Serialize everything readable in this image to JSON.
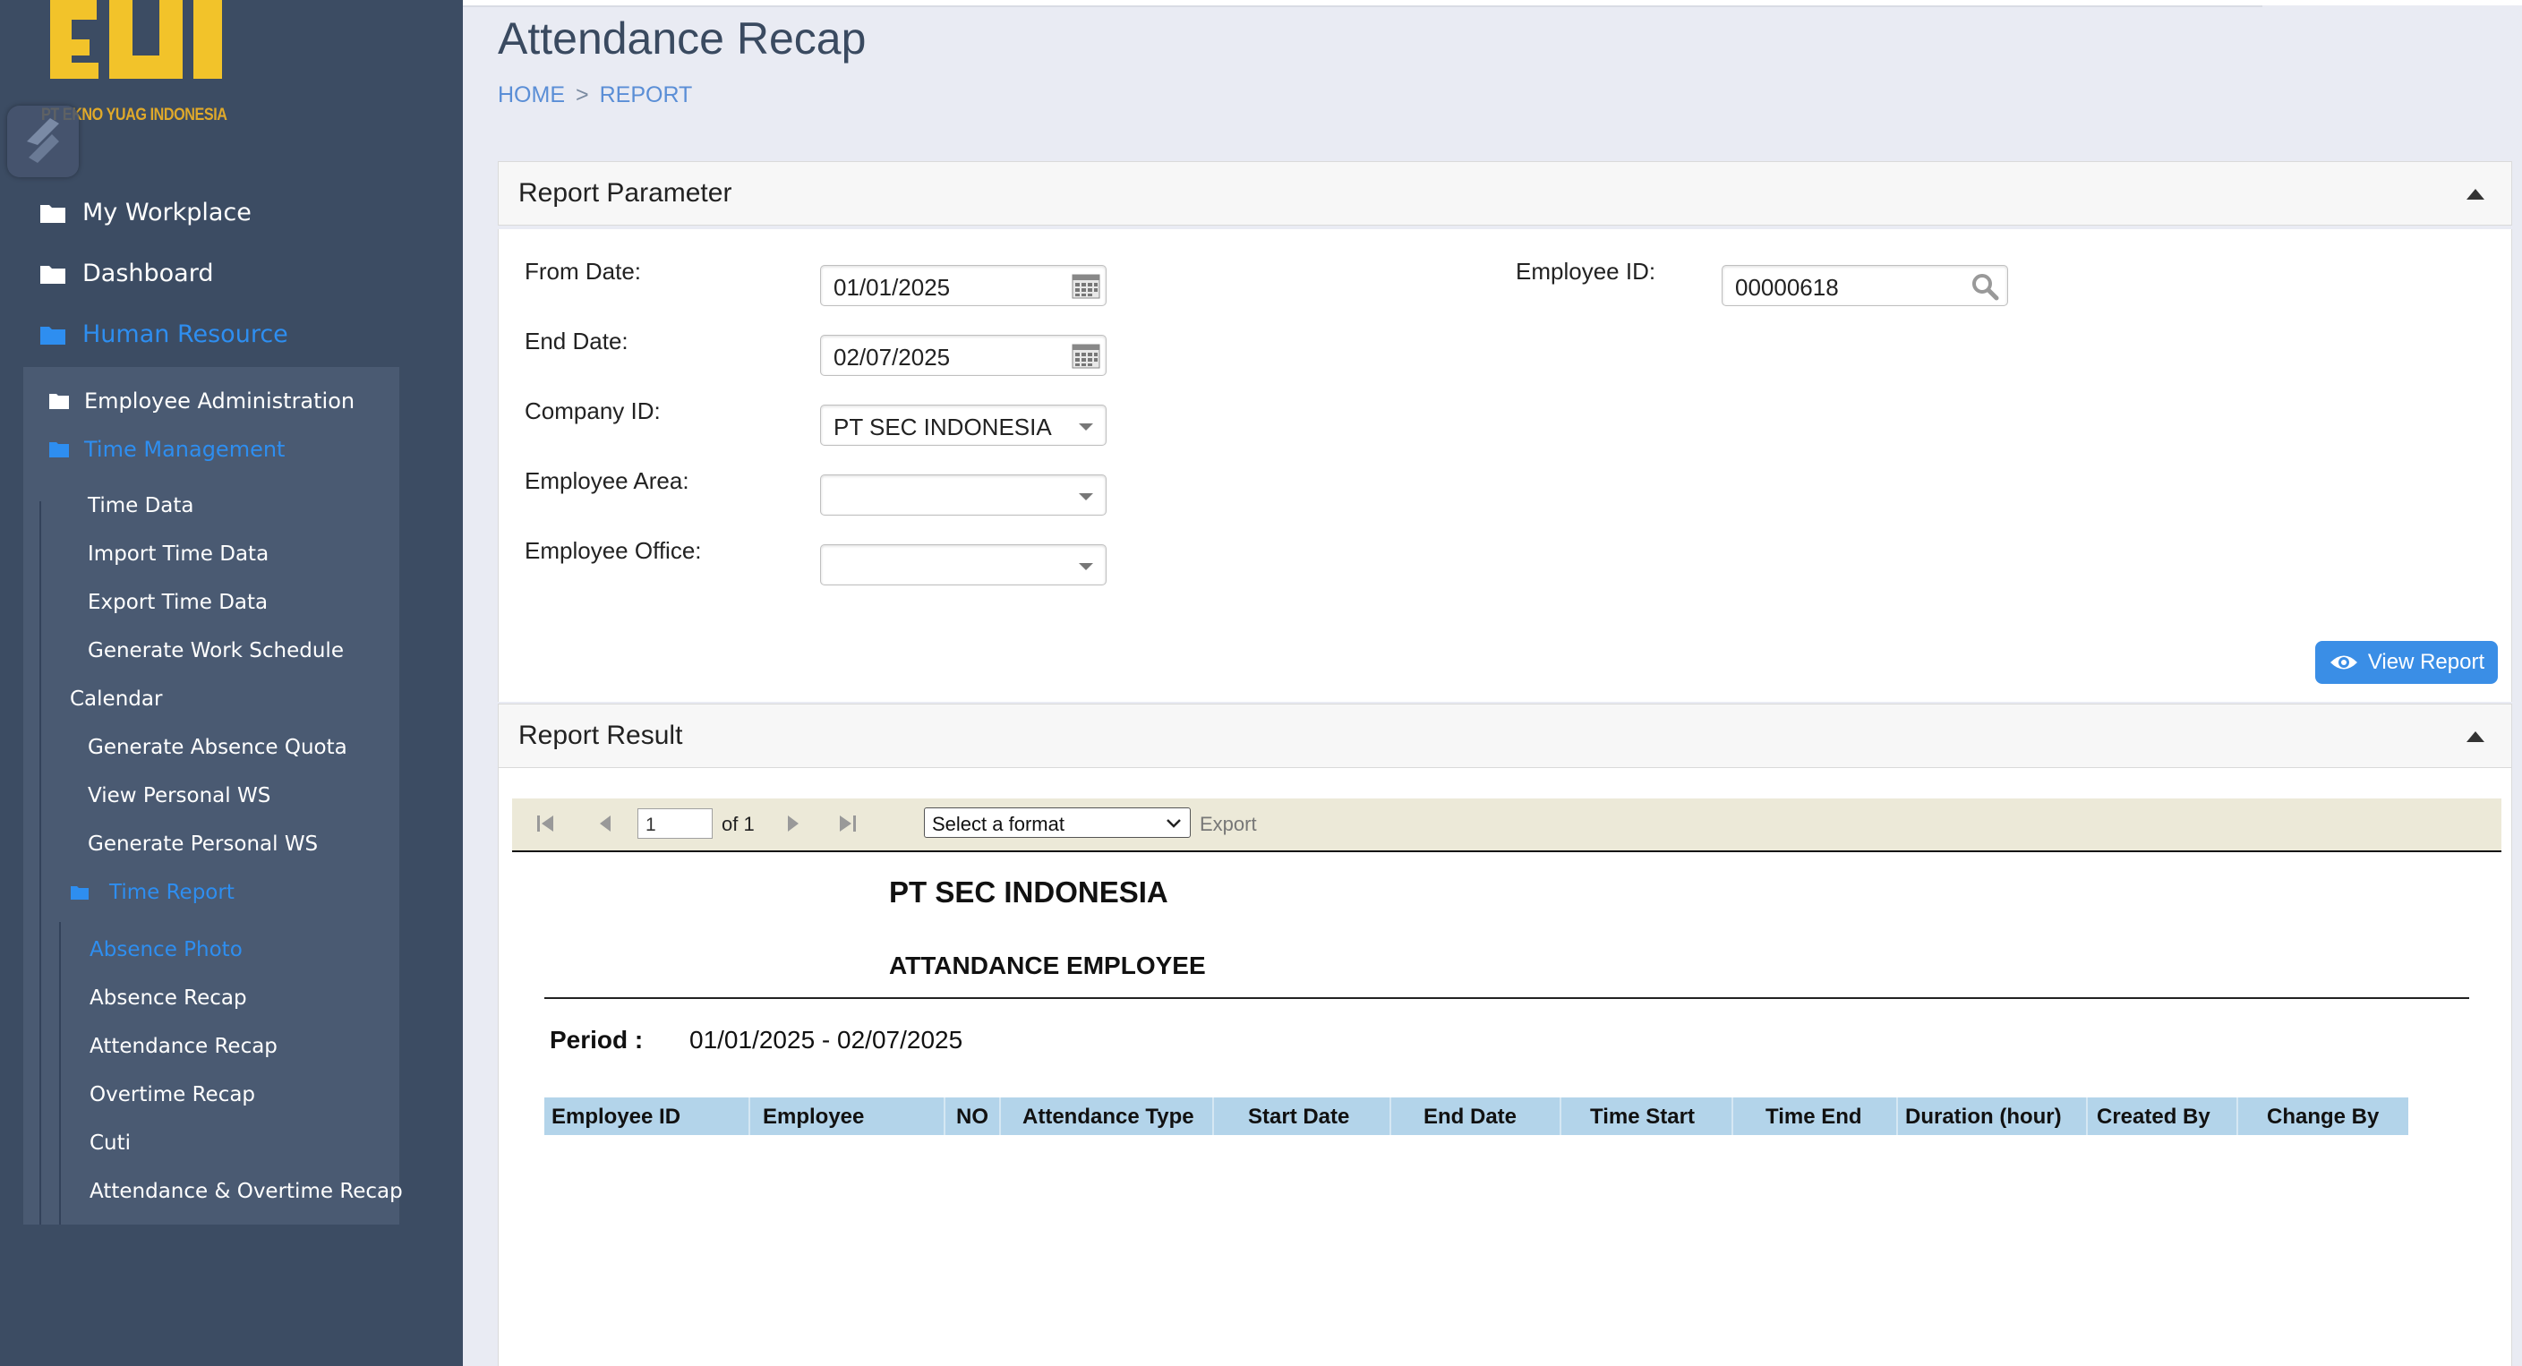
{
  "sidebar": {
    "logo_text": "PT EKNO YUAG INDONESIA",
    "items": [
      {
        "label": "My Workplace",
        "icon": "folder-icon"
      },
      {
        "label": "Dashboard",
        "icon": "folder-icon"
      },
      {
        "label": "Human Resource",
        "icon": "folder-icon",
        "active": true
      }
    ],
    "sub_items": [
      {
        "label": "Employee Administration",
        "icon": "folder-icon"
      },
      {
        "label": "Time Management",
        "icon": "folder-icon",
        "active": true
      }
    ],
    "time_management_items": [
      "Time Data",
      "Import Time Data",
      "Export Time Data",
      "Generate Work Schedule",
      "Calendar",
      "Generate Absence Quota",
      "View Personal WS",
      "Generate Personal WS",
      "Time Report"
    ],
    "time_report_items": [
      "Absence Photo",
      "Absence Recap",
      "Attendance Recap",
      "Overtime Recap",
      "Cuti",
      "Attendance & Overtime Recap"
    ],
    "active_color": "#2e8ef0"
  },
  "header": {
    "title": "Attendance Recap",
    "breadcrumb": [
      "HOME",
      "REPORT"
    ],
    "breadcrumb_sep": ">"
  },
  "report_parameter": {
    "title": "Report Parameter",
    "from_date_label": "From Date:",
    "from_date_value": "01/01/2025",
    "end_date_label": "End Date:",
    "end_date_value": "02/07/2025",
    "company_id_label": "Company ID:",
    "company_id_value": "PT SEC INDONESIA",
    "employee_area_label": "Employee Area:",
    "employee_area_value": "",
    "employee_office_label": "Employee Office:",
    "employee_office_value": "",
    "employee_id_label": "Employee ID:",
    "employee_id_value": "00000618",
    "view_report_label": "View Report"
  },
  "report_result": {
    "title": "Report Result",
    "toolbar": {
      "page_number": "1",
      "page_of": "of 1",
      "format_placeholder": "Select a format",
      "export_label": "Export"
    },
    "company_name": "PT SEC INDONESIA",
    "report_title": "ATTANDANCE EMPLOYEE",
    "period_label": "Period :",
    "period_value": "01/01/2025 - 02/07/2025",
    "columns": [
      "Employee ID",
      "Employee",
      "NO",
      "Attendance Type",
      "Start Date",
      "End Date",
      "Time Start",
      "Time End",
      "Duration (hour)",
      "Created By",
      "Change By"
    ],
    "header_color": "#b3d4ea"
  },
  "colors": {
    "sidebar_bg": "#3c4c63",
    "button_blue": "#3a8ee6",
    "logo_yellow": "#f2c32a"
  }
}
